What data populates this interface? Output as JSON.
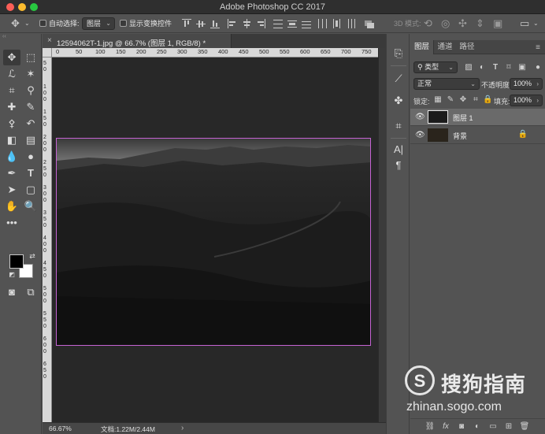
{
  "app": {
    "title": "Adobe Photoshop CC 2017"
  },
  "options_bar": {
    "auto_select_label": "自动选择:",
    "auto_select_value": "图层",
    "show_transform_label": "显示变换控件",
    "mode_3d_label": "3D 模式:"
  },
  "document": {
    "tab_title": "12594062T-1.jpg @ 66.7% (图层 1, RGB/8) *",
    "close_glyph": "×",
    "ruler_top_labels": [
      "0",
      "50",
      "100",
      "150",
      "200",
      "250",
      "300",
      "350",
      "400",
      "450",
      "500",
      "550",
      "600",
      "650",
      "700",
      "750"
    ],
    "ruler_left_labels": [
      "50",
      "100",
      "150",
      "200",
      "250",
      "300",
      "350",
      "400",
      "450",
      "500",
      "550",
      "600",
      "650"
    ]
  },
  "status_bar": {
    "zoom": "66.67%",
    "doc_info": "文档:1.22M/2.44M",
    "more": "›"
  },
  "layers_panel": {
    "tabs": [
      "图层",
      "通道",
      "路径"
    ],
    "filter_kind": "类型",
    "blend_mode": "正常",
    "opacity_label": "不透明度:",
    "opacity_value": "100%",
    "lock_label": "锁定:",
    "fill_label": "填充:",
    "fill_value": "100%",
    "layers": [
      {
        "name": "图层 1",
        "selected": true,
        "locked": false
      },
      {
        "name": "背景",
        "selected": false,
        "locked": true
      }
    ]
  },
  "watermark": {
    "logo_letter": "S",
    "brand": "搜狗指南",
    "url": "zhinan.sogo.com"
  },
  "colors": {
    "foreground": "#000000",
    "background": "#ffffff",
    "selection_border": "#c563d3"
  }
}
